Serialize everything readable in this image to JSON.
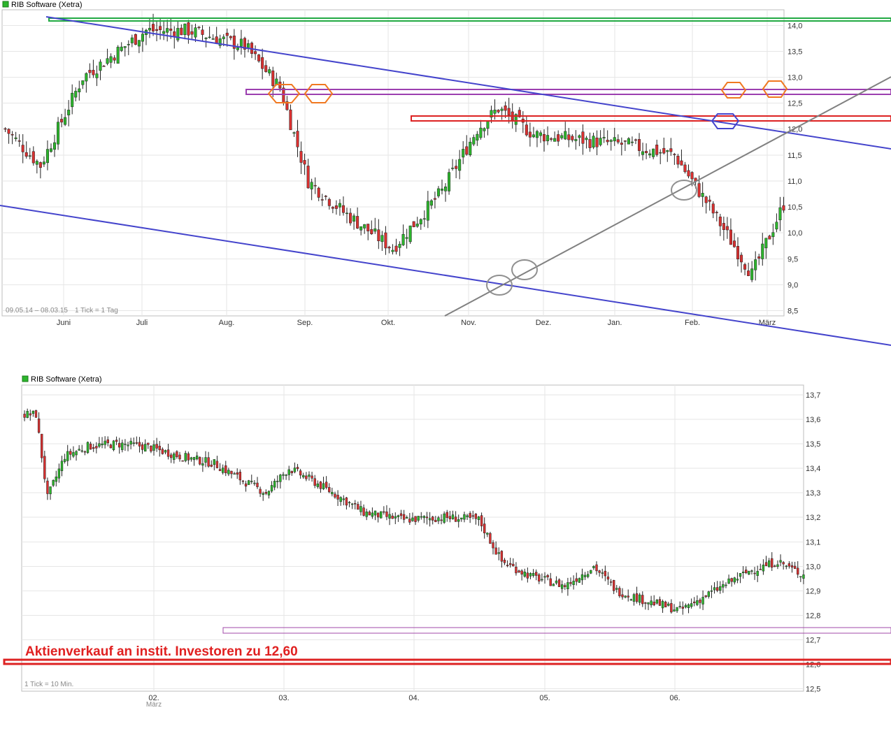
{
  "chart_data": [
    {
      "type": "candlestick",
      "title": "RIB Software (Xetra)",
      "range_label": "09.05.14 – 08.03.15",
      "tick_label": "1 Tick = 1 Tag",
      "x_labels": [
        "Juni",
        "Juli",
        "Aug.",
        "Sep.",
        "Okt.",
        "Nov.",
        "Dez.",
        "Jan.",
        "Feb.",
        "März"
      ],
      "y_ticks": [
        "14,0",
        "13,5",
        "13,0",
        "12,5",
        "12,0",
        "11,5",
        "11,0",
        "10,5",
        "10,0",
        "9,5",
        "9,0",
        "8,5"
      ],
      "ylim": [
        8.4,
        14.3
      ],
      "grid": true,
      "legend": "top-left",
      "colors": {
        "up": "#2cb52c",
        "down": "#d93030",
        "wick": "#222222"
      },
      "anchors": [
        [
          0,
          12.0
        ],
        [
          10,
          11.3
        ],
        [
          22,
          13.0
        ],
        [
          40,
          13.9
        ],
        [
          52,
          13.9
        ],
        [
          68,
          13.6
        ],
        [
          78,
          12.8
        ],
        [
          86,
          11.0
        ],
        [
          96,
          10.4
        ],
        [
          110,
          9.7
        ],
        [
          124,
          10.8
        ],
        [
          134,
          12.0
        ],
        [
          140,
          12.4
        ],
        [
          150,
          11.9
        ],
        [
          162,
          11.8
        ],
        [
          176,
          11.7
        ],
        [
          190,
          11.5
        ],
        [
          200,
          10.5
        ],
        [
          212,
          9.2
        ],
        [
          224,
          11.0
        ],
        [
          236,
          11.2
        ],
        [
          246,
          11.5
        ],
        [
          254,
          10.7
        ],
        [
          266,
          10.1
        ],
        [
          280,
          9.0
        ],
        [
          290,
          9.1
        ],
        [
          300,
          9.4
        ],
        [
          312,
          10.8
        ],
        [
          326,
          11.3
        ],
        [
          340,
          10.4
        ],
        [
          352,
          11.1
        ],
        [
          366,
          11.6
        ],
        [
          378,
          11.0
        ],
        [
          392,
          11.7
        ],
        [
          402,
          11.5
        ],
        [
          412,
          11.0
        ],
        [
          420,
          11.7
        ],
        [
          430,
          12.7
        ],
        [
          440,
          13.8
        ],
        [
          450,
          13.4
        ],
        [
          458,
          12.7
        ]
      ],
      "annotations": [
        {
          "type": "trendline",
          "color": "#4444cc",
          "from": [
            0,
            14.3
          ],
          "to": [
            458,
            11.5
          ]
        },
        {
          "type": "trendline",
          "color": "#4444cc",
          "from": [
            0,
            10.2
          ],
          "to": [
            458,
            7.3
          ]
        },
        {
          "type": "trendline",
          "color": "#808080",
          "from": [
            262,
            8.0
          ],
          "to": [
            458,
            12.6
          ]
        },
        {
          "type": "band",
          "color": "#22aa44",
          "value": 14.2
        },
        {
          "type": "band",
          "color": "#9c3fb0",
          "value": 12.55
        },
        {
          "type": "band",
          "color": "#dd2222",
          "value": 11.95
        }
      ]
    },
    {
      "type": "candlestick",
      "title": "RIB Software (Xetra)",
      "tick_label": "1 Tick = 10 Min.",
      "x_labels": [
        "02.",
        "03.",
        "04.",
        "05.",
        "06."
      ],
      "x_sublabel": "März",
      "y_ticks": [
        "13,7",
        "13,6",
        "13,5",
        "13,4",
        "13,3",
        "13,2",
        "13,1",
        "13,0",
        "12,9",
        "12,8",
        "12,7",
        "12,6",
        "12,5"
      ],
      "ylim": [
        12.49,
        13.74
      ],
      "grid": true,
      "legend": "top-left",
      "annotation_text": "Aktienverkauf an instit. Investoren zu 12,60",
      "anchors": [
        [
          0,
          13.62
        ],
        [
          4,
          13.62
        ],
        [
          8,
          13.28
        ],
        [
          14,
          13.45
        ],
        [
          22,
          13.49
        ],
        [
          32,
          13.5
        ],
        [
          42,
          13.49
        ],
        [
          54,
          13.45
        ],
        [
          66,
          13.42
        ],
        [
          76,
          13.35
        ],
        [
          84,
          13.3
        ],
        [
          92,
          13.4
        ],
        [
          100,
          13.35
        ],
        [
          110,
          13.28
        ],
        [
          118,
          13.22
        ],
        [
          132,
          13.19
        ],
        [
          146,
          13.2
        ],
        [
          158,
          13.19
        ],
        [
          166,
          13.02
        ],
        [
          176,
          12.96
        ],
        [
          188,
          12.92
        ],
        [
          198,
          13.0
        ],
        [
          206,
          12.9
        ],
        [
          216,
          12.86
        ],
        [
          228,
          12.82
        ],
        [
          240,
          12.9
        ],
        [
          252,
          12.98
        ],
        [
          262,
          13.02
        ],
        [
          270,
          12.97
        ],
        [
          278,
          12.94
        ],
        [
          282,
          12.8
        ],
        [
          290,
          12.64
        ],
        [
          300,
          12.62
        ],
        [
          312,
          12.63
        ],
        [
          322,
          12.7
        ],
        [
          334,
          12.73
        ],
        [
          344,
          12.65
        ],
        [
          356,
          12.7
        ],
        [
          368,
          12.74
        ],
        [
          378,
          12.65
        ],
        [
          390,
          12.66
        ],
        [
          402,
          12.68
        ],
        [
          414,
          12.62
        ],
        [
          426,
          12.65
        ],
        [
          436,
          12.66
        ],
        [
          444,
          12.78
        ],
        [
          456,
          12.8
        ],
        [
          470,
          12.81
        ],
        [
          484,
          12.79
        ],
        [
          496,
          12.8
        ],
        [
          506,
          12.77
        ],
        [
          514,
          12.82
        ],
        [
          520,
          12.9
        ],
        [
          524,
          12.92
        ]
      ]
    }
  ]
}
